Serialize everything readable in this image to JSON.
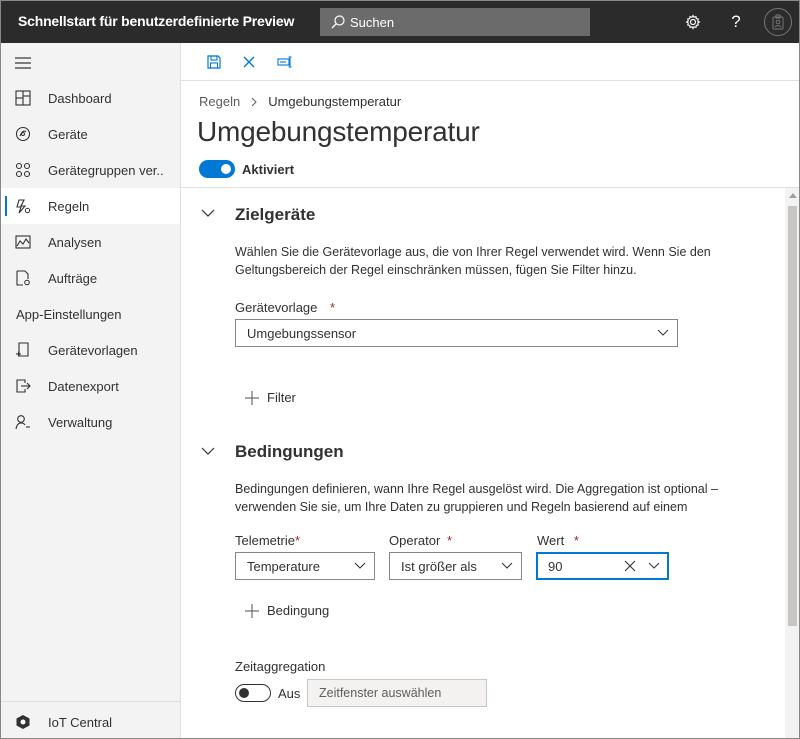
{
  "app": {
    "title": "Schnellstart für benutzerdefinierte Preview",
    "search_placeholder": "Suchen"
  },
  "sidebar": {
    "items": [
      {
        "label": "Dashboard",
        "icon": "dashboard-icon"
      },
      {
        "label": "Geräte",
        "icon": "devices-icon"
      },
      {
        "label": "Gerätegruppen ver..",
        "icon": "device-groups-icon"
      },
      {
        "label": "Regeln",
        "icon": "rules-icon",
        "active": true
      },
      {
        "label": "Analysen",
        "icon": "analytics-icon"
      },
      {
        "label": "Aufträge",
        "icon": "jobs-icon"
      }
    ],
    "section_label": "App-Einstellungen",
    "settings_items": [
      {
        "label": "Gerätevorlagen",
        "icon": "device-templates-icon"
      },
      {
        "label": "Datenexport",
        "icon": "data-export-icon"
      },
      {
        "label": "Verwaltung",
        "icon": "administration-icon"
      }
    ],
    "footer_label": "IoT Central"
  },
  "breadcrumb": {
    "root": "Regeln",
    "current": "Umgebungstemperatur"
  },
  "page": {
    "title": "Umgebungstemperatur",
    "enabled_label": "Aktiviert",
    "enabled": true
  },
  "target_devices": {
    "title": "Zielgeräte",
    "description": "Wählen Sie die Gerätevorlage aus, die von Ihrer Regel verwendet wird. Wenn Sie den Geltungsbereich der Regel einschränken müssen, fügen Sie Filter hinzu.",
    "template_label": "Gerätevorlage",
    "required_mark": "*",
    "template_value": "Umgebungssensor",
    "add_filter_label": "Filter"
  },
  "conditions": {
    "title": "Bedingungen",
    "description": "Bedingungen definieren, wann Ihre Regel ausgelöst wird. Die Aggregation ist optional – verwenden Sie sie, um Ihre Daten zu gruppieren und Regeln basierend auf einem",
    "telemetry_label": "Telemetrie",
    "telemetry_value": "Temperature",
    "operator_label": "Operator",
    "operator_value": "Ist größer als",
    "value_label": "Wert",
    "value_value": "90",
    "required_mark": "*",
    "add_condition_label": "Bedingung"
  },
  "time_aggregation": {
    "label": "Zeitaggregation",
    "state_label": "Aus",
    "enabled": false,
    "window_placeholder": "Zeitfenster auswählen"
  },
  "colors": {
    "accent": "#0078d4",
    "topbar": "#2b2b2b",
    "sidebar": "#f3f3f3",
    "required": "#a4262c"
  }
}
